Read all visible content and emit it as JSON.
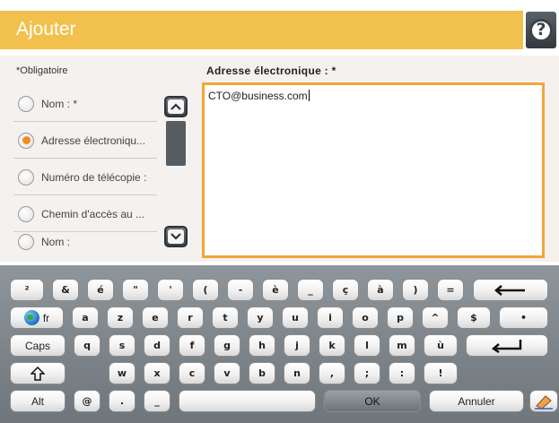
{
  "header": {
    "title": "Ajouter",
    "help_icon": "help-icon",
    "help_glyph": "?"
  },
  "form": {
    "required_note": "*Obligatoire",
    "options": [
      {
        "label": "Nom : *",
        "selected": false
      },
      {
        "label": "Adresse électroniqu...",
        "selected": true
      },
      {
        "label": "Numéro de télécopie :",
        "selected": false
      },
      {
        "label": "Chemin d'accès au ...",
        "selected": false
      },
      {
        "label": "Nom :",
        "selected": false
      }
    ],
    "field_title": "Adresse électronique : *",
    "field_value": "CTO@business.com"
  },
  "keyboard": {
    "row1": [
      "²",
      "&",
      "é",
      "\"",
      "'",
      "(",
      "-",
      "è",
      "_",
      "ç",
      "à",
      ")",
      "="
    ],
    "row2": [
      "a",
      "z",
      "e",
      "r",
      "t",
      "y",
      "u",
      "i",
      "o",
      "p",
      "^",
      "$",
      "•"
    ],
    "row3": [
      "q",
      "s",
      "d",
      "f",
      "g",
      "h",
      "j",
      "k",
      "l",
      "m",
      "ù"
    ],
    "row4": [
      "w",
      "x",
      "c",
      "v",
      "b",
      "n",
      ",",
      ";",
      ":",
      "!"
    ],
    "lang_label": "fr",
    "caps_label": "Caps",
    "alt_label": "Alt",
    "at_label": "@",
    "dot_label": ".",
    "underscore_label": "_",
    "ok_label": "OK",
    "cancel_label": "Annuler",
    "backspace_glyph": "⟵",
    "enter_glyph": "↵",
    "shift_glyph": "⇧"
  },
  "colors": {
    "header_bar": "#f2c04d",
    "selected_radio": "#f28c1e",
    "text_border": "#f2a53a"
  }
}
